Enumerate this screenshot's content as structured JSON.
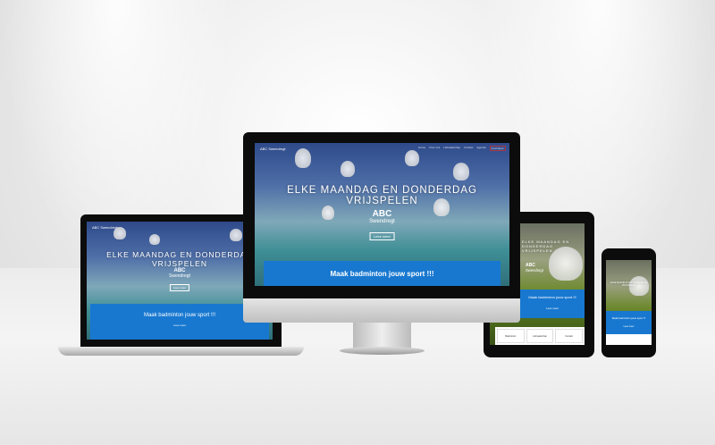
{
  "site": {
    "logo": "ABC Swendregt",
    "logo_line1": "ABC",
    "logo_line2": "Swendregt",
    "nav": [
      "Home",
      "Over ons",
      "Lidmaatschap",
      "Contact",
      "Agenda",
      "Inschrijven"
    ],
    "hero_title": "ELKE MAANDAG EN DONDERDAG VRIJSPELEN",
    "hero_button": "Lees meer",
    "band_title": "Maak badminton jouw sport !!!",
    "band_link": "Lees meer",
    "mobile_hero": "ELKE MAANDAG EN DONDERDAG VRIJSPELEN",
    "features": [
      "Badminton",
      "Lidmaatschap",
      "Contact"
    ]
  },
  "colors": {
    "brand_blue": "#1878d0",
    "bezel": "#0c0c0c"
  }
}
